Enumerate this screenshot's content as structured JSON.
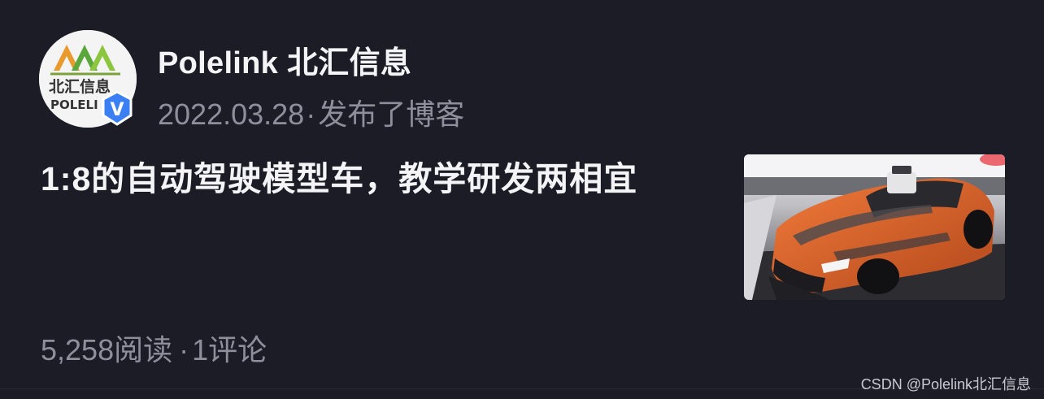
{
  "post": {
    "author_name": "Polelink 北汇信息",
    "date": "2022.03.28",
    "separator": "·",
    "action": "发布了博客",
    "title": "1:8的自动驾驶模型车，教学研发两相宜",
    "reads": "5,258",
    "reads_label": "阅读",
    "stats_separator": "·",
    "comments": "1",
    "comments_label": "评论"
  },
  "avatar": {
    "logo_text_cn": "北汇信息",
    "logo_text_en": "POLELI",
    "badge_letter": "V",
    "badge_color": "#3b7ff5",
    "logo_orange": "#e89a2c",
    "logo_green": "#5aa83b"
  },
  "thumbnail": {
    "subject": "orange-autonomous-model-car",
    "car_color": "#d9622b"
  },
  "watermark": "CSDN @Polelink北汇信息"
}
